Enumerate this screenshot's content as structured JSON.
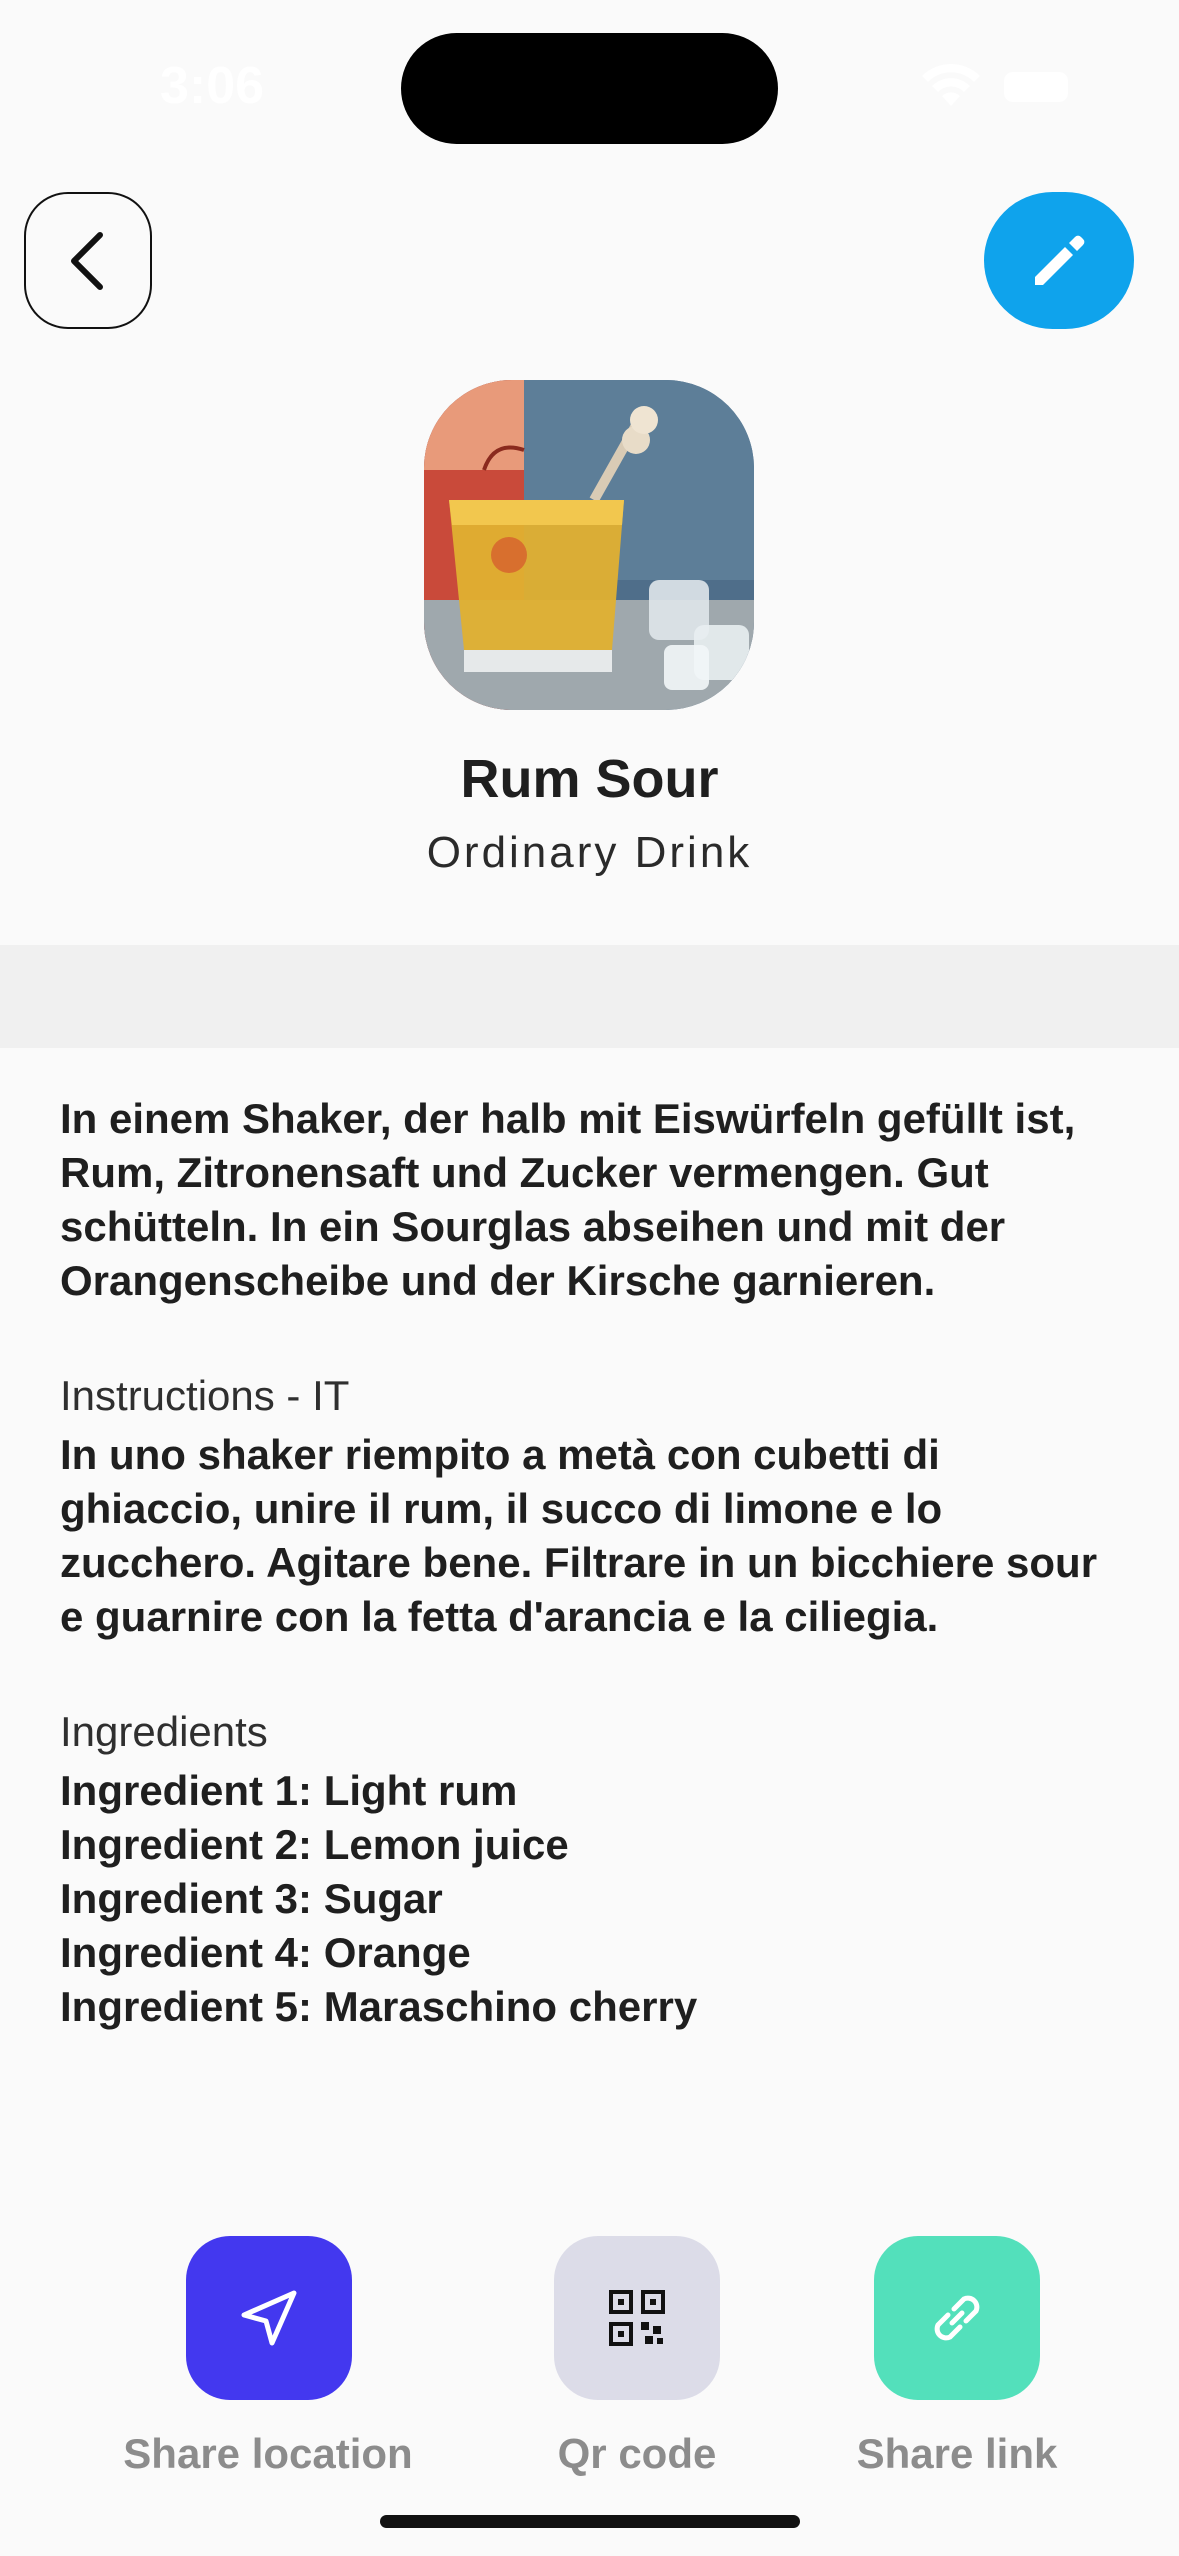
{
  "status_bar": {
    "time": "3:06"
  },
  "header": {
    "back_icon": "chevron-left-icon",
    "edit_icon": "pencil-icon",
    "edit_color": "#0fa3ec"
  },
  "drink": {
    "name": "Rum Sour",
    "category": "Ordinary Drink",
    "instructions_de": "In einem Shaker, der halb mit Eiswürfeln gefüllt ist, Rum, Zitronensaft und Zucker vermengen. Gut schütteln. In ein Sourglas abseihen und mit der Orangenscheibe und der Kirsche garnieren.",
    "instructions_it_label": "Instructions - IT",
    "instructions_it": "In uno shaker riempito a metà con cubetti di ghiaccio, unire il rum, il succo di limone e lo zucchero. Agitare bene. Filtrare in un bicchiere sour e guarnire con la fetta d'arancia e la ciliegia.",
    "ingredients_label": "Ingredients",
    "ingredients": [
      "Ingredient 1: Light rum",
      "Ingredient 2: Lemon juice",
      "Ingredient 3: Sugar",
      "Ingredient 4: Orange",
      "Ingredient 5: Maraschino cherry"
    ]
  },
  "actions": [
    {
      "label": "Share location",
      "icon": "navigation-arrow-icon",
      "color": "#4338ef"
    },
    {
      "label": "Qr code",
      "icon": "qr-code-icon",
      "color": "#dcdce8"
    },
    {
      "label": "Share link",
      "icon": "link-icon",
      "color": "#53e0bb"
    }
  ]
}
